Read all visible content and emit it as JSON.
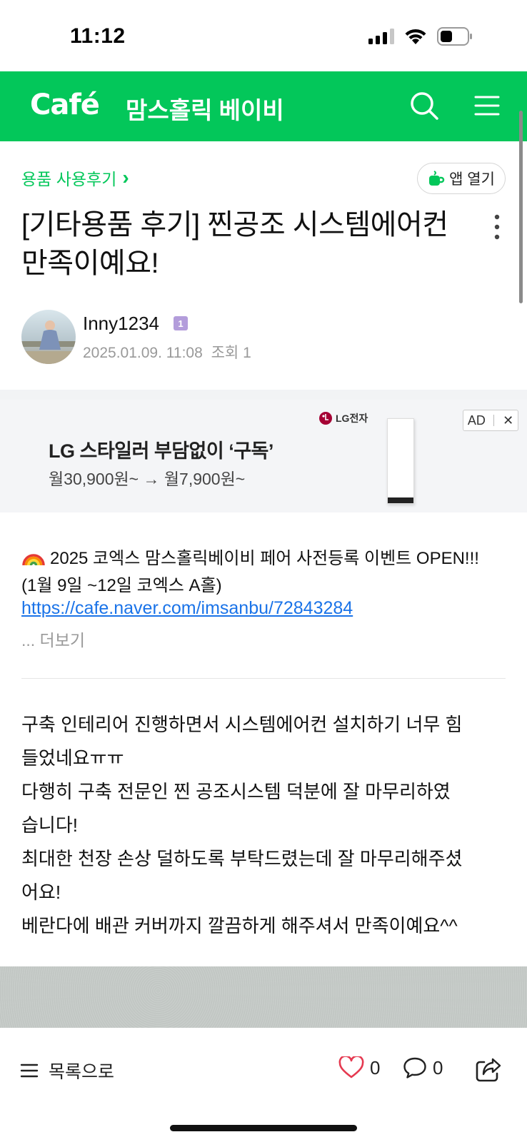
{
  "status_bar": {
    "time": "11:12",
    "icons": [
      "cellular-signal-icon",
      "wifi-icon",
      "battery-icon"
    ]
  },
  "header": {
    "logo": "Café",
    "cafe_name": "맘스홀릭 베이비",
    "icons": [
      "search-icon",
      "hamburger-menu-icon"
    ],
    "background_color": "#03c75a"
  },
  "breadcrumb": {
    "label": "용품 사용후기",
    "chevron": "›"
  },
  "app_open_button": {
    "label": "앱 열기",
    "icon": "cafe-cup-icon"
  },
  "post": {
    "title": "[기타용품 후기] 찐공조 시스템에어컨 만족이예요!",
    "author": "Inny1234",
    "level": "1",
    "date": "2025.01.09. 11:08",
    "views_label": "조회 1"
  },
  "ad": {
    "brand": "LG전자",
    "headline": "LG 스타일러 부담없이 ‘구독’",
    "price": "월30,900원~ → 월7,900원~",
    "badge": "AD",
    "close": "✕"
  },
  "notice": {
    "emoji": "🌈",
    "line1": "2025 코엑스 맘스홀릭베이비 페어 사전등록 이벤트 OPEN!!!",
    "line2": "(1월 9일 ~12일 코엑스 A홀)",
    "link": "https://cafe.naver.com/imsanbu/72843284",
    "more": "... 더보기"
  },
  "body": {
    "lines": [
      "구축 인테리어 진행하면서 시스템에어컨 설치하기 너무 힘",
      "들었네요ㅠㅠ",
      "다행히 구축 전문인 찐 공조시스템 덕분에 잘 마무리하였",
      "습니다!",
      "최대한 천장 손상 덜하도록 부탁드렸는데 잘 마무리해주셨",
      "어요!",
      "베란다에 배관 커버까지 깔끔하게 해주셔서 만족이예요^^"
    ]
  },
  "bottom_bar": {
    "list_label": "목록으로",
    "like_count": "0",
    "comment_count": "0",
    "icons": [
      "list-icon",
      "heart-icon",
      "comment-icon",
      "share-icon"
    ]
  }
}
